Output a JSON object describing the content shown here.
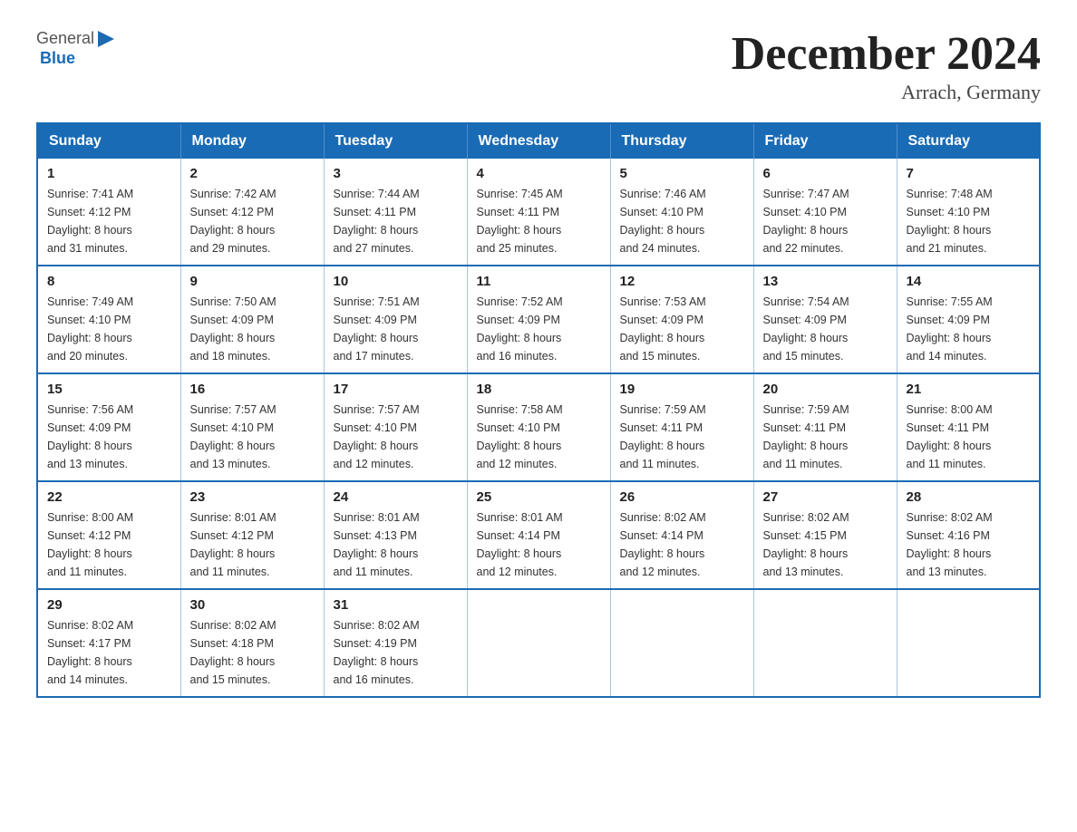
{
  "header": {
    "title": "December 2024",
    "subtitle": "Arrach, Germany",
    "logo_general": "General",
    "logo_blue": "Blue"
  },
  "days_of_week": [
    "Sunday",
    "Monday",
    "Tuesday",
    "Wednesday",
    "Thursday",
    "Friday",
    "Saturday"
  ],
  "weeks": [
    [
      {
        "day": "1",
        "sunrise": "7:41 AM",
        "sunset": "4:12 PM",
        "daylight": "8 hours and 31 minutes."
      },
      {
        "day": "2",
        "sunrise": "7:42 AM",
        "sunset": "4:12 PM",
        "daylight": "8 hours and 29 minutes."
      },
      {
        "day": "3",
        "sunrise": "7:44 AM",
        "sunset": "4:11 PM",
        "daylight": "8 hours and 27 minutes."
      },
      {
        "day": "4",
        "sunrise": "7:45 AM",
        "sunset": "4:11 PM",
        "daylight": "8 hours and 25 minutes."
      },
      {
        "day": "5",
        "sunrise": "7:46 AM",
        "sunset": "4:10 PM",
        "daylight": "8 hours and 24 minutes."
      },
      {
        "day": "6",
        "sunrise": "7:47 AM",
        "sunset": "4:10 PM",
        "daylight": "8 hours and 22 minutes."
      },
      {
        "day": "7",
        "sunrise": "7:48 AM",
        "sunset": "4:10 PM",
        "daylight": "8 hours and 21 minutes."
      }
    ],
    [
      {
        "day": "8",
        "sunrise": "7:49 AM",
        "sunset": "4:10 PM",
        "daylight": "8 hours and 20 minutes."
      },
      {
        "day": "9",
        "sunrise": "7:50 AM",
        "sunset": "4:09 PM",
        "daylight": "8 hours and 18 minutes."
      },
      {
        "day": "10",
        "sunrise": "7:51 AM",
        "sunset": "4:09 PM",
        "daylight": "8 hours and 17 minutes."
      },
      {
        "day": "11",
        "sunrise": "7:52 AM",
        "sunset": "4:09 PM",
        "daylight": "8 hours and 16 minutes."
      },
      {
        "day": "12",
        "sunrise": "7:53 AM",
        "sunset": "4:09 PM",
        "daylight": "8 hours and 15 minutes."
      },
      {
        "day": "13",
        "sunrise": "7:54 AM",
        "sunset": "4:09 PM",
        "daylight": "8 hours and 15 minutes."
      },
      {
        "day": "14",
        "sunrise": "7:55 AM",
        "sunset": "4:09 PM",
        "daylight": "8 hours and 14 minutes."
      }
    ],
    [
      {
        "day": "15",
        "sunrise": "7:56 AM",
        "sunset": "4:09 PM",
        "daylight": "8 hours and 13 minutes."
      },
      {
        "day": "16",
        "sunrise": "7:57 AM",
        "sunset": "4:10 PM",
        "daylight": "8 hours and 13 minutes."
      },
      {
        "day": "17",
        "sunrise": "7:57 AM",
        "sunset": "4:10 PM",
        "daylight": "8 hours and 12 minutes."
      },
      {
        "day": "18",
        "sunrise": "7:58 AM",
        "sunset": "4:10 PM",
        "daylight": "8 hours and 12 minutes."
      },
      {
        "day": "19",
        "sunrise": "7:59 AM",
        "sunset": "4:11 PM",
        "daylight": "8 hours and 11 minutes."
      },
      {
        "day": "20",
        "sunrise": "7:59 AM",
        "sunset": "4:11 PM",
        "daylight": "8 hours and 11 minutes."
      },
      {
        "day": "21",
        "sunrise": "8:00 AM",
        "sunset": "4:11 PM",
        "daylight": "8 hours and 11 minutes."
      }
    ],
    [
      {
        "day": "22",
        "sunrise": "8:00 AM",
        "sunset": "4:12 PM",
        "daylight": "8 hours and 11 minutes."
      },
      {
        "day": "23",
        "sunrise": "8:01 AM",
        "sunset": "4:12 PM",
        "daylight": "8 hours and 11 minutes."
      },
      {
        "day": "24",
        "sunrise": "8:01 AM",
        "sunset": "4:13 PM",
        "daylight": "8 hours and 11 minutes."
      },
      {
        "day": "25",
        "sunrise": "8:01 AM",
        "sunset": "4:14 PM",
        "daylight": "8 hours and 12 minutes."
      },
      {
        "day": "26",
        "sunrise": "8:02 AM",
        "sunset": "4:14 PM",
        "daylight": "8 hours and 12 minutes."
      },
      {
        "day": "27",
        "sunrise": "8:02 AM",
        "sunset": "4:15 PM",
        "daylight": "8 hours and 13 minutes."
      },
      {
        "day": "28",
        "sunrise": "8:02 AM",
        "sunset": "4:16 PM",
        "daylight": "8 hours and 13 minutes."
      }
    ],
    [
      {
        "day": "29",
        "sunrise": "8:02 AM",
        "sunset": "4:17 PM",
        "daylight": "8 hours and 14 minutes."
      },
      {
        "day": "30",
        "sunrise": "8:02 AM",
        "sunset": "4:18 PM",
        "daylight": "8 hours and 15 minutes."
      },
      {
        "day": "31",
        "sunrise": "8:02 AM",
        "sunset": "4:19 PM",
        "daylight": "8 hours and 16 minutes."
      },
      null,
      null,
      null,
      null
    ]
  ],
  "labels": {
    "sunrise": "Sunrise:",
    "sunset": "Sunset:",
    "daylight": "Daylight:"
  }
}
